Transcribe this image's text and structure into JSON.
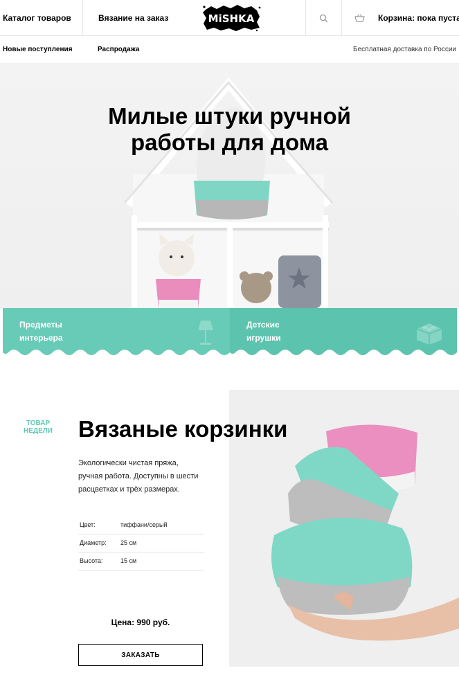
{
  "header": {
    "catalog_label": "Каталог товаров",
    "custom_knitting_label": "Вязание на заказ",
    "logo_text": "MiSHKA",
    "cart_label": "Корзина: пока пуста"
  },
  "subnav": {
    "new_arrivals_label": "Новые поступления",
    "sale_label": "Распродажа",
    "delivery_note": "Бесплатная доставка по России"
  },
  "hero": {
    "title_line1": "Милые штуки ручной",
    "title_line2": "работы для дома"
  },
  "categories": [
    {
      "label_line1": "Предметы",
      "label_line2": "интерьера",
      "icon": "lamp-icon",
      "color": "#68cbb7"
    },
    {
      "label_line1": "Детские",
      "label_line2": "игрушки",
      "icon": "lego-brick-icon",
      "color": "#5cc3ae"
    }
  ],
  "product": {
    "badge_line1": "Товар",
    "badge_line2": "недели",
    "title": "Вязаные корзинки",
    "desc_line1": "Экологически чистая пряжа,",
    "desc_line2": "ручная работа. Доступны в шести",
    "desc_line3": "расцветках и трёх размерах.",
    "specs": [
      {
        "key": "Цвет:",
        "value": "тиффани/серый"
      },
      {
        "key": "Диаметр:",
        "value": "25 см"
      },
      {
        "key": "Высота:",
        "value": "15 см"
      }
    ],
    "price": "Цена: 990 руб.",
    "order_label": "Заказать"
  },
  "colors": {
    "accent": "#5ec9b5",
    "mint": "#77d3bf",
    "pink": "#e888b7",
    "gray": "#b9b9b9"
  }
}
